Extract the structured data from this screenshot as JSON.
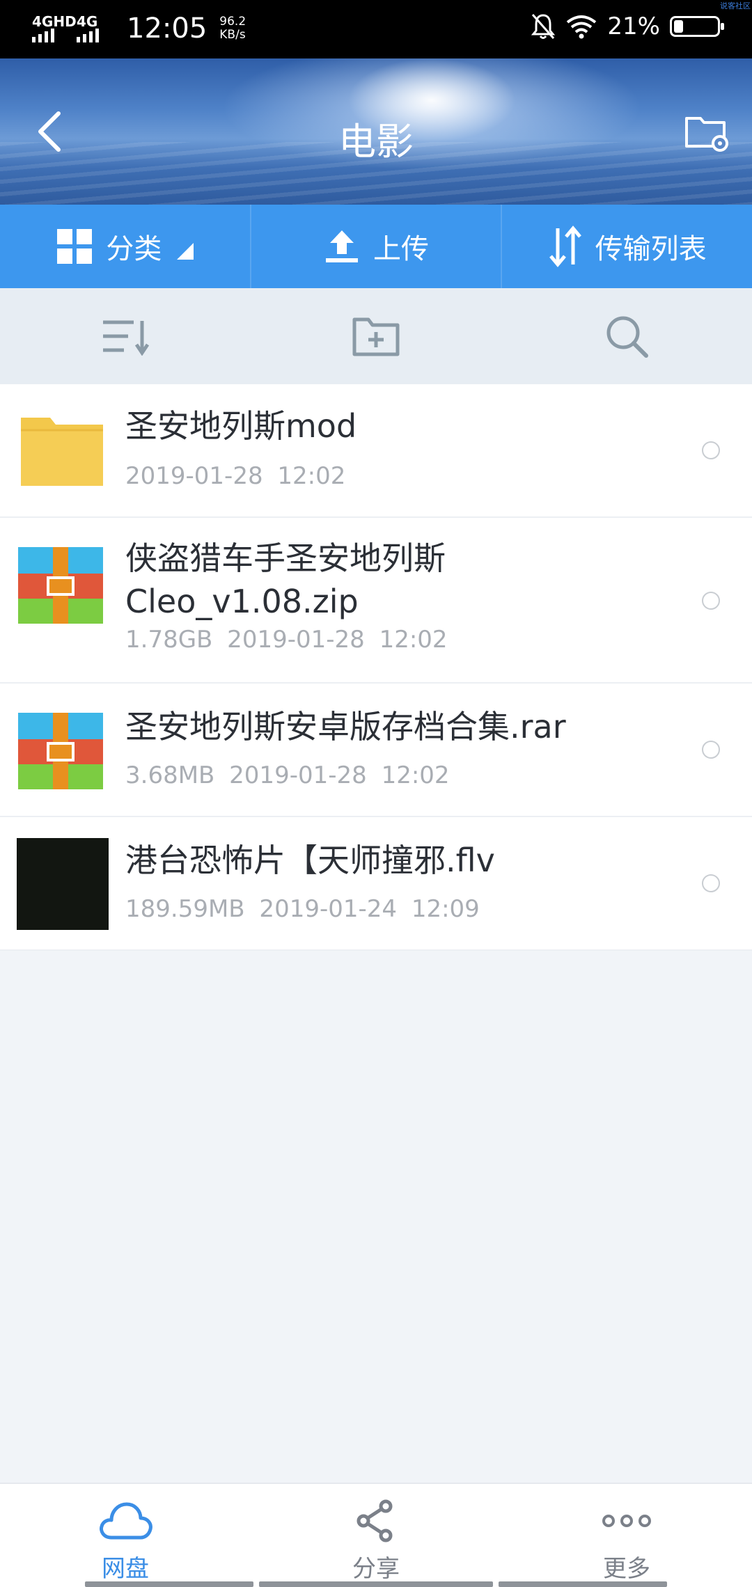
{
  "status_bar": {
    "net1": "4GHD",
    "net2": "4G",
    "time": "12:05",
    "speed_value": "96.2",
    "speed_unit": "KB/s",
    "battery": "21%",
    "battery_level": 0.21,
    "watermark": "说客社区"
  },
  "header": {
    "title": "电影"
  },
  "toolbar": {
    "category": "分类",
    "upload": "上传",
    "transfer": "传输列表"
  },
  "files": [
    {
      "name": "圣安地列斯mod",
      "meta": "2019-01-28  12:02",
      "type": "folder-icon"
    },
    {
      "name_line1": "侠盗猎车手圣安地列斯",
      "name_line2": "Cleo_v1.08.zip",
      "meta": "1.78GB  2019-01-28  12:02",
      "type": "archive-icon"
    },
    {
      "name": "圣安地列斯安卓版存档合集.rar",
      "meta": "3.68MB  2019-01-28  12:02",
      "type": "archive-icon"
    },
    {
      "name": "港台恐怖片【天师撞邪.flv",
      "meta": "189.59MB  2019-01-24  12:09",
      "type": "video-thumbnail"
    }
  ],
  "bottom_nav": {
    "disk": "网盘",
    "share": "分享",
    "more": "更多"
  },
  "colors": {
    "accent": "#3d97ee",
    "folder": "#f3c84b",
    "active_tab": "#3b8ee6"
  }
}
